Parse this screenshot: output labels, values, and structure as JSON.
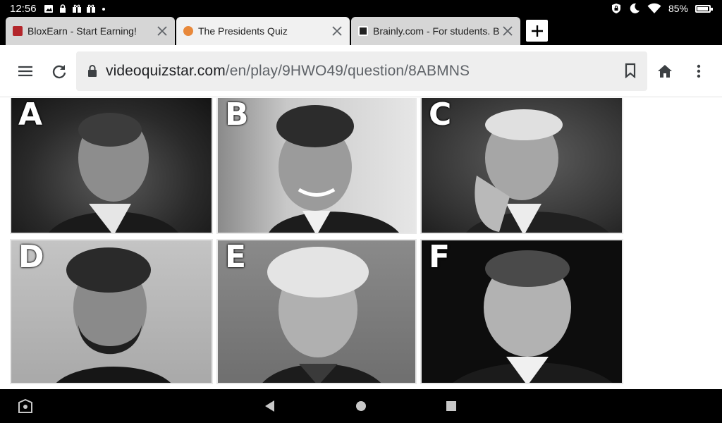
{
  "status_bar": {
    "time": "12:56",
    "battery_percent": "85%",
    "battery_level": 0.85,
    "left_icons": [
      "image-icon",
      "lock-icon",
      "gift-icon",
      "gift-icon",
      "dot-icon"
    ],
    "right_icons": [
      "vpn-lock-icon",
      "moon-icon",
      "wifi-icon",
      "battery-charging-icon"
    ]
  },
  "tabs": [
    {
      "title": "BloxEarn - Start Earning!",
      "favicon": "bloxearn-favicon",
      "favicon_color": "#b3262b",
      "active": false
    },
    {
      "title": "The Presidents Quiz",
      "favicon": "quiz-favicon",
      "favicon_color": "#e8883a",
      "active": true
    },
    {
      "title": "Brainly.com - For students. By students.",
      "favicon": "brainly-favicon",
      "favicon_color": "#222222",
      "active": false
    }
  ],
  "toolbar": {
    "url_host": "videoquizstar.com",
    "url_path": "/en/play/9HWO49/question/8ABMNS"
  },
  "quiz": {
    "options": [
      {
        "letter": "A"
      },
      {
        "letter": "B"
      },
      {
        "letter": "C"
      },
      {
        "letter": "D"
      },
      {
        "letter": "E"
      },
      {
        "letter": "F"
      }
    ]
  },
  "nav_bar": {
    "icons": [
      "assistant-icon",
      "back-triangle-icon",
      "home-circle-icon",
      "recents-square-icon"
    ]
  },
  "colors": {
    "browser_chrome": "#000000",
    "active_tab": "#f1f1f1",
    "inactive_tab": "#d6d6d6",
    "omnibox": "#eeeeee"
  }
}
